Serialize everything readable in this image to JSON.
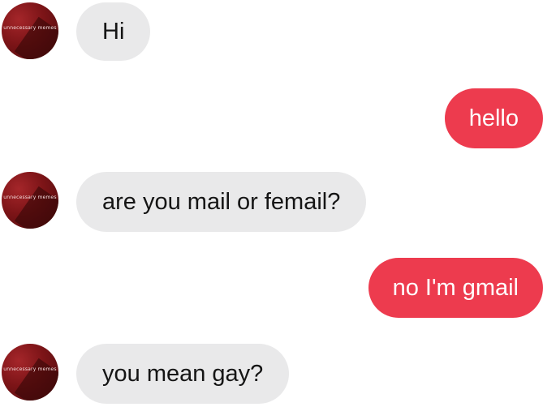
{
  "avatar": {
    "caption": "unnecessary memes"
  },
  "messages": [
    {
      "sender": "them",
      "text": "Hi"
    },
    {
      "sender": "me",
      "text": "hello"
    },
    {
      "sender": "them",
      "text": "are you mail or femail?"
    },
    {
      "sender": "me",
      "text": "no I'm gmail"
    },
    {
      "sender": "them",
      "text": "you mean gay?"
    }
  ],
  "colors": {
    "incoming_bubble": "#e9e9ea",
    "outgoing_bubble": "#ed3b4e",
    "outgoing_text": "#ffffff",
    "incoming_text": "#151515",
    "avatar": "#8b1a1d"
  }
}
